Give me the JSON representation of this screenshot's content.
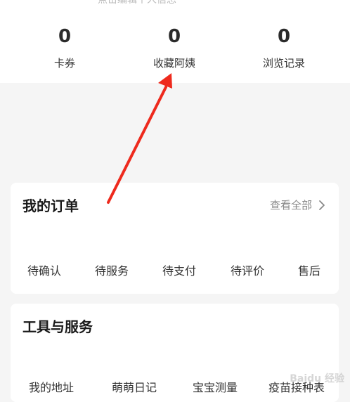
{
  "profile": {
    "edit_hint": "点击编辑个人信息",
    "stats": [
      {
        "value": "0",
        "label": "卡券"
      },
      {
        "value": "0",
        "label": "收藏阿姨"
      },
      {
        "value": "0",
        "label": "浏览记录"
      }
    ]
  },
  "orders": {
    "title": "我的订单",
    "view_all": "查看全部",
    "items": [
      "待确认",
      "待服务",
      "待支付",
      "待评价",
      "售后"
    ]
  },
  "tools": {
    "title": "工具与服务",
    "items": [
      "我的地址",
      "萌萌日记",
      "宝宝测量",
      "疫苗接种表"
    ]
  },
  "annotation": {
    "color": "#ee2a1d"
  },
  "watermark": "Baidu 经验"
}
